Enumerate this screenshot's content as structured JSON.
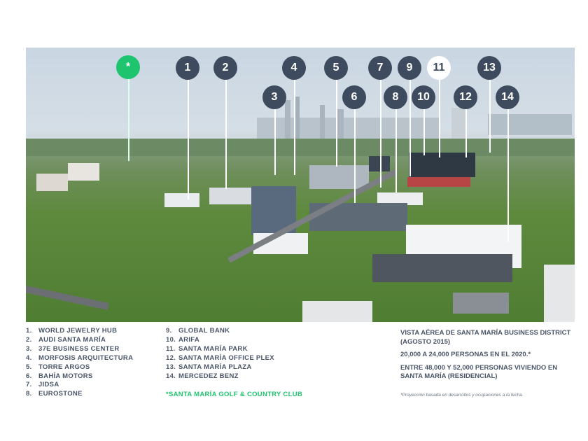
{
  "markers": [
    "*",
    "1",
    "2",
    "3",
    "4",
    "5",
    "6",
    "7",
    "8",
    "9",
    "10",
    "11",
    "12",
    "13",
    "14"
  ],
  "legend_left": [
    {
      "n": "1.",
      "label": "WORLD JEWELRY HUB"
    },
    {
      "n": "2.",
      "label": "AUDI SANTA MARÍA"
    },
    {
      "n": "3.",
      "label": "37E BUSINESS CENTER"
    },
    {
      "n": "4.",
      "label": "MORFOSIS ARQUITECTURA"
    },
    {
      "n": "5.",
      "label": "TORRE ARGOS"
    },
    {
      "n": "6.",
      "label": "BAHÍA MOTORS"
    },
    {
      "n": "7.",
      "label": "JIDSA"
    },
    {
      "n": "8.",
      "label": "EUROSTONE"
    }
  ],
  "legend_right": [
    {
      "n": "9.",
      "label": "GLOBAL BANK"
    },
    {
      "n": "10.",
      "label": "ARIFA"
    },
    {
      "n": "11.",
      "label": "SANTA MARÍA PARK"
    },
    {
      "n": "12.",
      "label": "SANTA MARÍA OFFICE PLEX"
    },
    {
      "n": "13.",
      "label": "SANTA MARÍA PLAZA"
    },
    {
      "n": "14.",
      "label": "MERCEDEZ BENZ"
    }
  ],
  "golf_club": "*SANTA MARÍA GOLF & COUNTRY CLUB",
  "info": {
    "title": "VISTA AÉREA DE SANTA MARÍA BUSINESS DISTRICT (AGOSTO 2015)",
    "stat1": "20,000 A 24,000 PERSONAS EN EL 2020.*",
    "stat2": "ENTRE 48,000 Y 52,000 PERSONAS VIVIENDO EN SANTA MARÍA (RESIDENCIAL)",
    "footnote": "*Proyección basada en desarrollos y ocupaciones a la fecha."
  },
  "colors": {
    "marker": "#3e4b5e",
    "accent": "#1fc46f"
  }
}
